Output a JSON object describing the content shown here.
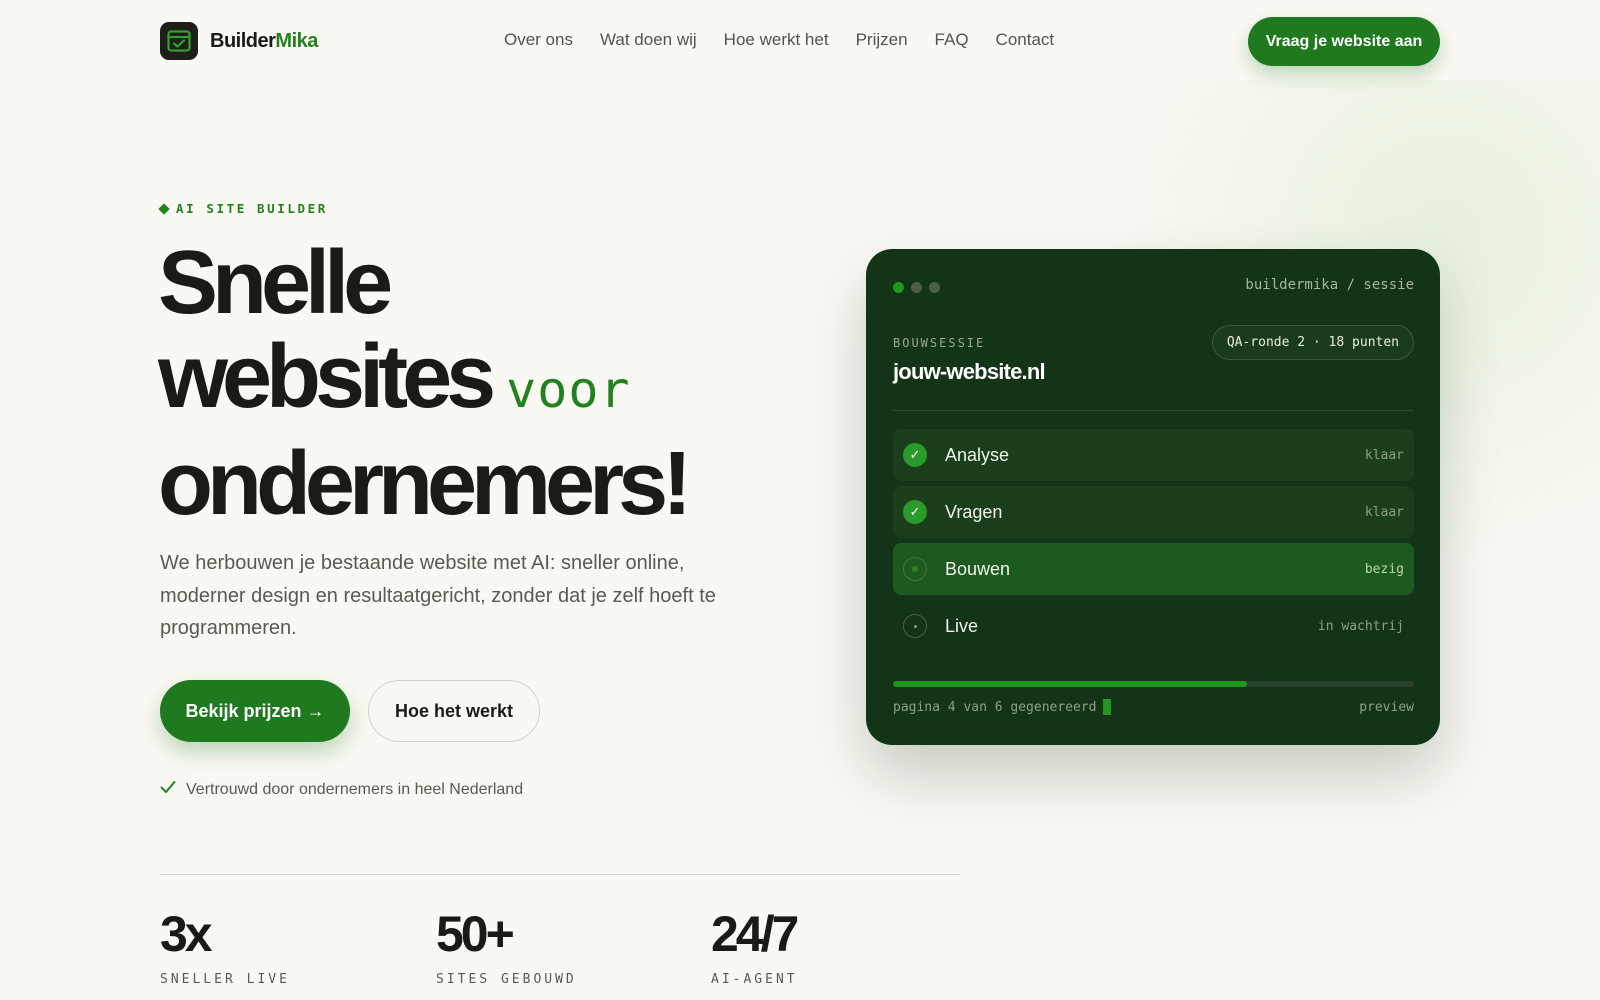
{
  "nav": {
    "logo": {
      "part1": "Builder",
      "part2": "Mika"
    },
    "links": [
      "Over ons",
      "Wat doen wij",
      "Hoe werkt het",
      "Prijzen",
      "FAQ",
      "Contact"
    ],
    "cta": "Vraag je website aan"
  },
  "hero": {
    "eyebrow": "AI SITE BUILDER",
    "headline": {
      "line1": "Snelle",
      "line2": "websites",
      "accent": "voor",
      "line3": "ondernemers!"
    },
    "subtitle": "We herbouwen je bestaande website met AI: sneller online, moderner design en resultaatgericht, zonder dat je zelf hoeft te programmeren.",
    "primary_button": "Bekijk prijzen →",
    "secondary_button": "Hoe het werkt",
    "trust_text": "Vertrouwd door ondernemers in heel Nederland"
  },
  "stats": [
    {
      "value": "3x",
      "label": "SNELLER LIVE"
    },
    {
      "value": "50+",
      "label": "SITES GEBOUWD"
    },
    {
      "value": "24/7",
      "label": "AI-AGENT"
    }
  ],
  "session_card": {
    "path": "buildermika / sessie",
    "label": "BOUWSESSIE",
    "url": "jouw-website.nl",
    "badge": "QA-ronde 2 · 18 punten",
    "steps": [
      {
        "name": "Analyse",
        "status": "klaar",
        "state": "done"
      },
      {
        "name": "Vragen",
        "status": "klaar",
        "state": "done"
      },
      {
        "name": "Bouwen",
        "status": "bezig",
        "state": "running"
      },
      {
        "name": "Live",
        "status": "in wachtrij",
        "state": "queued"
      }
    ],
    "progress": 0.68,
    "footer_left": "pagina 4 van 6 gegenereerd",
    "footer_right": "preview"
  },
  "colors": {
    "accent": "#1f7a1f",
    "card_bg": "#133416",
    "page_bg": "#faf8f3",
    "window_dots": [
      "#239522",
      "#4a5f47",
      "#4a5f47"
    ]
  }
}
